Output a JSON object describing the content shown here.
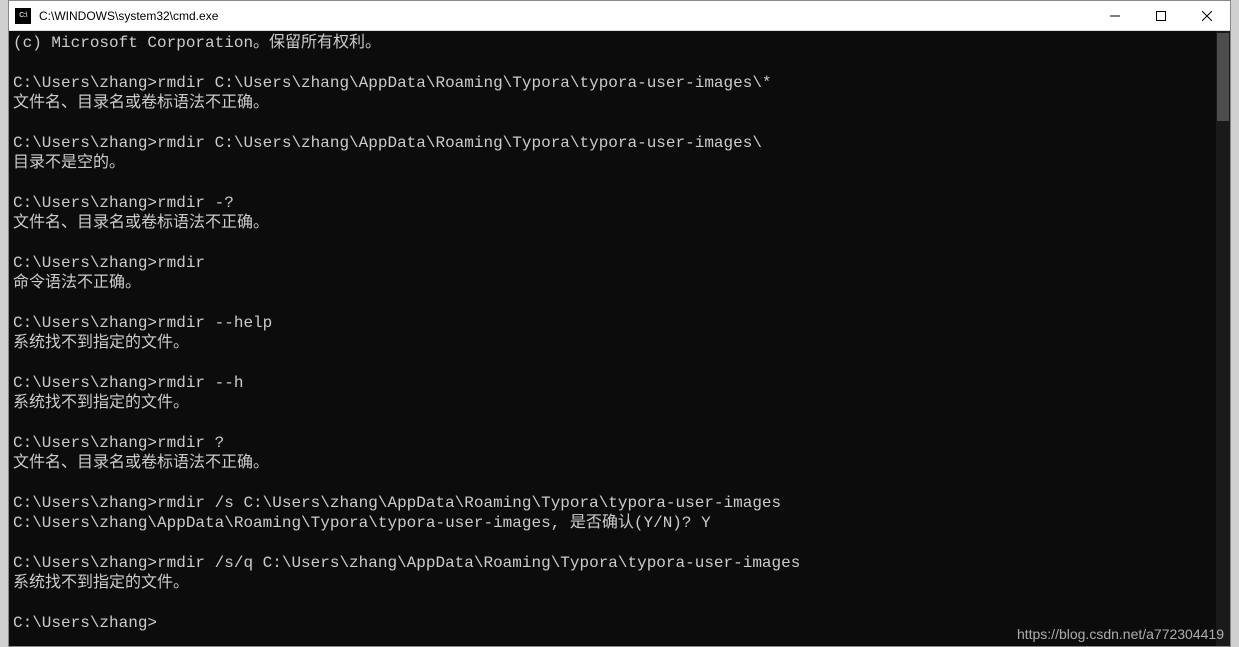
{
  "window": {
    "title": "C:\\WINDOWS\\system32\\cmd.exe",
    "icon_label": "CMD"
  },
  "terminal": {
    "lines": [
      "(c) Microsoft Corporation。保留所有权利。",
      "",
      "C:\\Users\\zhang>rmdir C:\\Users\\zhang\\AppData\\Roaming\\Typora\\typora-user-images\\*",
      "文件名、目录名或卷标语法不正确。",
      "",
      "C:\\Users\\zhang>rmdir C:\\Users\\zhang\\AppData\\Roaming\\Typora\\typora-user-images\\",
      "目录不是空的。",
      "",
      "C:\\Users\\zhang>rmdir -?",
      "文件名、目录名或卷标语法不正确。",
      "",
      "C:\\Users\\zhang>rmdir",
      "命令语法不正确。",
      "",
      "C:\\Users\\zhang>rmdir --help",
      "系统找不到指定的文件。",
      "",
      "C:\\Users\\zhang>rmdir --h",
      "系统找不到指定的文件。",
      "",
      "C:\\Users\\zhang>rmdir ?",
      "文件名、目录名或卷标语法不正确。",
      "",
      "C:\\Users\\zhang>rmdir /s C:\\Users\\zhang\\AppData\\Roaming\\Typora\\typora-user-images",
      "C:\\Users\\zhang\\AppData\\Roaming\\Typora\\typora-user-images, 是否确认(Y/N)? Y",
      "",
      "C:\\Users\\zhang>rmdir /s/q C:\\Users\\zhang\\AppData\\Roaming\\Typora\\typora-user-images",
      "系统找不到指定的文件。",
      "",
      "C:\\Users\\zhang>"
    ]
  },
  "watermark": "https://blog.csdn.net/a772304419"
}
